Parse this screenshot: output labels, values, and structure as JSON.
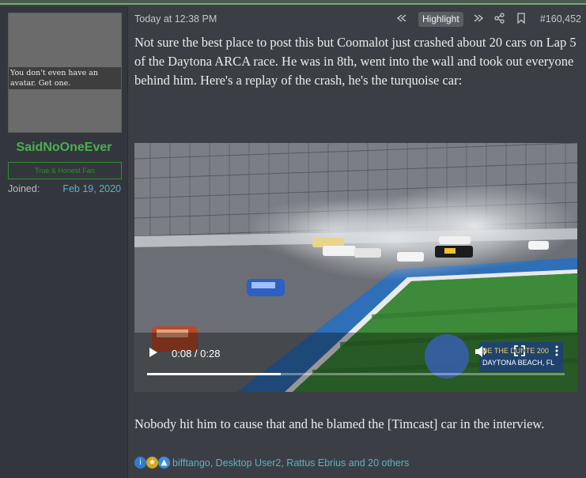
{
  "user": {
    "avatar_note": "You don't even have an avatar. Get one.",
    "name": "SaidNoOneEver",
    "title": "True & Honest Fan",
    "joined_label": "Joined:",
    "joined_value": "Feb 19, 2020"
  },
  "post": {
    "timestamp": "Today at 12:38 PM",
    "highlight_label": "Highlight",
    "post_number": "#160,452",
    "paragraph1": "Not sure the best place to post this but Coomalot just crashed about 20 cars on Lap 5 of the Daytona ARCA race. He was in 8th, went into the wall and took out everyone behind him. Here's a replay of the crash, he's the turquoise car:",
    "paragraph2": "Nobody hit him to cause that and he blamed the [Timcast] car in the interview."
  },
  "video": {
    "time": "0:08 / 0:28",
    "progress": 0.32,
    "icons": [
      "play-icon",
      "volume-icon",
      "fullscreen-icon",
      "more-icon"
    ],
    "overlay_text": "DE THE DUNTE 200",
    "overlay_text2": "DAYTONA BEACH, FL"
  },
  "reactions": {
    "names": "bifftango, Desktop User2, Rattus Ebrius and 20 others",
    "icons": [
      "informative-icon",
      "winner-icon",
      "like-icon"
    ]
  },
  "colors": {
    "accent_green": "#4caf50",
    "link": "#5fb0c0",
    "background": "#3b3f45"
  }
}
